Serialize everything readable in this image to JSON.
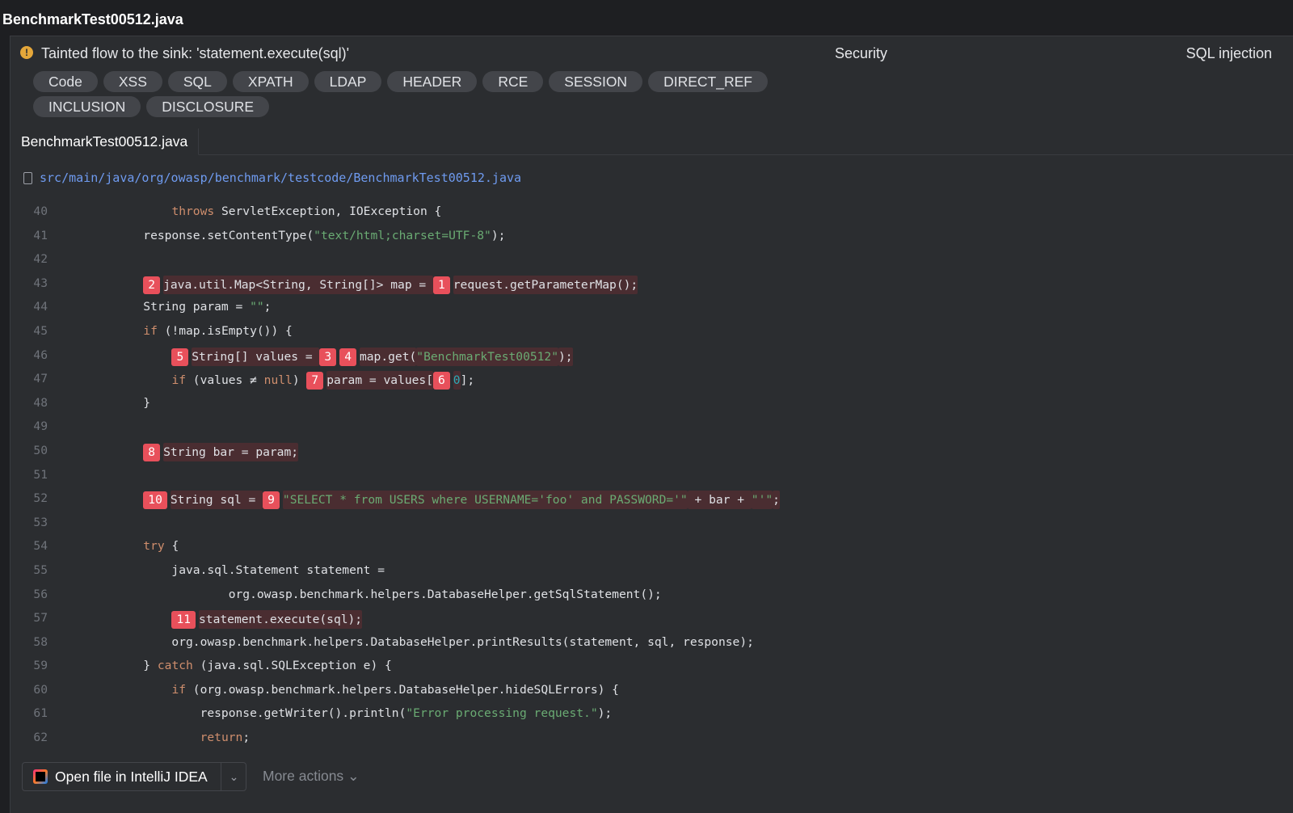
{
  "window": {
    "title": "BenchmarkTest00512.java"
  },
  "problem": {
    "warning_icon": "!",
    "description": "Tainted flow to the sink: 'statement.execute(sql)'",
    "category": "Security",
    "type": "SQL injection"
  },
  "tags": [
    "Code",
    "XSS",
    "SQL",
    "XPATH",
    "LDAP",
    "HEADER",
    "RCE",
    "SESSION",
    "DIRECT_REF",
    "INCLUSION",
    "DISCLOSURE"
  ],
  "tab": {
    "label": "BenchmarkTest00512.java"
  },
  "file": {
    "path": "src/main/java/org/owasp/benchmark/testcode/BenchmarkTest00512.java"
  },
  "code": {
    "lines": [
      {
        "n": "40",
        "t": [
          {
            "c": "            "
          },
          {
            "k": "throws"
          },
          {
            "c": " ServletException, IOException {"
          }
        ]
      },
      {
        "n": "41",
        "t": [
          {
            "c": "        response.setContentType("
          },
          {
            "s": "\"text/html;charset=UTF-8\""
          },
          {
            "c": ");"
          }
        ]
      },
      {
        "n": "42",
        "t": []
      },
      {
        "n": "43",
        "t": [
          {
            "c": "        "
          },
          {
            "m": "2"
          },
          {
            "h": "java.util.Map<String, String[]> map = "
          },
          {
            "m": "1"
          },
          {
            "h": "request.getParameterMap();"
          }
        ]
      },
      {
        "n": "44",
        "t": [
          {
            "c": "        String param = "
          },
          {
            "s": "\"\""
          },
          {
            "c": ";"
          }
        ]
      },
      {
        "n": "45",
        "t": [
          {
            "c": "        "
          },
          {
            "k": "if"
          },
          {
            "c": " (!map.isEmpty()) {"
          }
        ]
      },
      {
        "n": "46",
        "t": [
          {
            "c": "            "
          },
          {
            "m": "5"
          },
          {
            "h": "String[] values = "
          },
          {
            "m": "3"
          },
          {
            "m": "4"
          },
          {
            "h": "map.get("
          },
          {
            "hs": "\"BenchmarkTest00512\""
          },
          {
            "h": ");"
          }
        ]
      },
      {
        "n": "47",
        "t": [
          {
            "c": "            "
          },
          {
            "k": "if"
          },
          {
            "c": " (values ≠ "
          },
          {
            "k": "null"
          },
          {
            "c": ") "
          },
          {
            "m": "7"
          },
          {
            "h": "param = values["
          },
          {
            "m": "6"
          },
          {
            "hn": "0"
          },
          {
            "c": "];"
          }
        ]
      },
      {
        "n": "48",
        "t": [
          {
            "c": "        }"
          }
        ]
      },
      {
        "n": "49",
        "t": []
      },
      {
        "n": "50",
        "t": [
          {
            "c": "        "
          },
          {
            "m": "8"
          },
          {
            "h": "String bar = param;"
          }
        ]
      },
      {
        "n": "51",
        "t": []
      },
      {
        "n": "52",
        "t": [
          {
            "c": "        "
          },
          {
            "m": "10"
          },
          {
            "h": "String sql = "
          },
          {
            "m": "9"
          },
          {
            "hs": "\"SELECT * from USERS where USERNAME='foo' and PASSWORD='\""
          },
          {
            "h": " + bar + "
          },
          {
            "hs": "\"'\""
          },
          {
            "h": ";"
          }
        ]
      },
      {
        "n": "53",
        "t": []
      },
      {
        "n": "54",
        "t": [
          {
            "c": "        "
          },
          {
            "k": "try"
          },
          {
            "c": " {"
          }
        ]
      },
      {
        "n": "55",
        "t": [
          {
            "c": "            java.sql.Statement statement ="
          }
        ]
      },
      {
        "n": "56",
        "t": [
          {
            "c": "                    org.owasp.benchmark.helpers.DatabaseHelper.getSqlStatement();"
          }
        ]
      },
      {
        "n": "57",
        "t": [
          {
            "c": "            "
          },
          {
            "m": "11"
          },
          {
            "h": "statement.execute(sql);"
          }
        ]
      },
      {
        "n": "58",
        "t": [
          {
            "c": "            org.owasp.benchmark.helpers.DatabaseHelper.printResults(statement, sql, response);"
          }
        ]
      },
      {
        "n": "59",
        "t": [
          {
            "c": "        } "
          },
          {
            "k": "catch"
          },
          {
            "c": " (java.sql.SQLException e) {"
          }
        ]
      },
      {
        "n": "60",
        "t": [
          {
            "c": "            "
          },
          {
            "k": "if"
          },
          {
            "c": " (org.owasp.benchmark.helpers.DatabaseHelper.hideSQLErrors) {"
          }
        ]
      },
      {
        "n": "61",
        "t": [
          {
            "c": "                response.getWriter().println("
          },
          {
            "s": "\"Error processing request.\""
          },
          {
            "c": ");"
          }
        ]
      },
      {
        "n": "62",
        "t": [
          {
            "c": "                "
          },
          {
            "k": "return"
          },
          {
            "c": ";"
          }
        ]
      }
    ]
  },
  "actions": {
    "open_file_label": "Open file in IntelliJ IDEA",
    "dropdown_icon": "chevron-down-icon",
    "more_actions_label": "More actions ⌄"
  },
  "colors": {
    "background": "#2b2d30",
    "keyword": "#cf8e6d",
    "string": "#6aab73",
    "marker": "#e8505b",
    "highlight": "#4a2d31",
    "link": "#6f9bf0"
  }
}
